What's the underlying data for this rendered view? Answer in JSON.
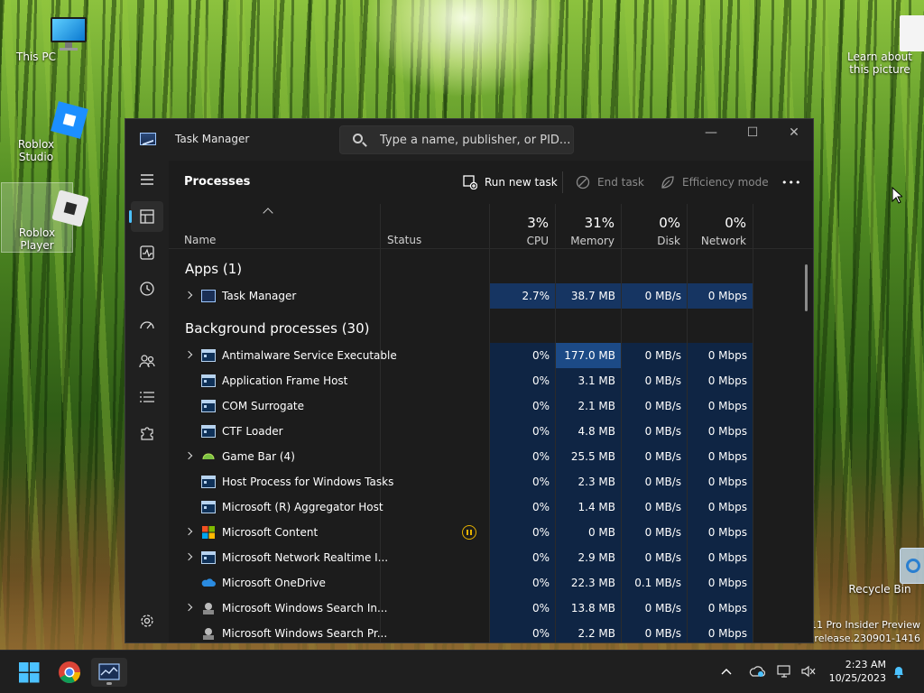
{
  "desktop": {
    "icons": {
      "this_pc": "This PC",
      "roblox_studio": "Roblox Studio",
      "roblox_player": "Roblox Player",
      "learn_about": "Learn about this picture",
      "recycle_bin": "Recycle Bin"
    },
    "watermark_line1": "11 Pro Insider Preview",
    "watermark_line2": "prerelease.230901-1416"
  },
  "window": {
    "title": "Task Manager",
    "search_placeholder": "Type a name, publisher, or PID...",
    "min_label": "—",
    "max_label": "☐",
    "close_label": "✕"
  },
  "header": {
    "page_title": "Processes",
    "run_new_task": "Run new task",
    "end_task": "End task",
    "efficiency_mode": "Efficiency mode",
    "more": "•••"
  },
  "columns": {
    "name": "Name",
    "status": "Status",
    "cpu_pct": "3%",
    "cpu": "CPU",
    "memory_pct": "31%",
    "memory": "Memory",
    "disk_pct": "0%",
    "disk": "Disk",
    "network_pct": "0%",
    "network": "Network"
  },
  "groups": {
    "apps": "Apps (1)",
    "background": "Background processes (30)"
  },
  "apps": [
    {
      "name": "Task Manager",
      "cpu": "2.7%",
      "memory": "38.7 MB",
      "disk": "0 MB/s",
      "network": "0 Mbps"
    }
  ],
  "background": [
    {
      "name": "Antimalware Service Executable",
      "cpu": "0%",
      "memory": "177.0 MB",
      "disk": "0 MB/s",
      "network": "0 Mbps"
    },
    {
      "name": "Application Frame Host",
      "cpu": "0%",
      "memory": "3.1 MB",
      "disk": "0 MB/s",
      "network": "0 Mbps"
    },
    {
      "name": "COM Surrogate",
      "cpu": "0%",
      "memory": "2.1 MB",
      "disk": "0 MB/s",
      "network": "0 Mbps"
    },
    {
      "name": "CTF Loader",
      "cpu": "0%",
      "memory": "4.8 MB",
      "disk": "0 MB/s",
      "network": "0 Mbps"
    },
    {
      "name": "Game Bar (4)",
      "cpu": "0%",
      "memory": "25.5 MB",
      "disk": "0 MB/s",
      "network": "0 Mbps"
    },
    {
      "name": "Host Process for Windows Tasks",
      "cpu": "0%",
      "memory": "2.3 MB",
      "disk": "0 MB/s",
      "network": "0 Mbps"
    },
    {
      "name": "Microsoft (R) Aggregator Host",
      "cpu": "0%",
      "memory": "1.4 MB",
      "disk": "0 MB/s",
      "network": "0 Mbps"
    },
    {
      "name": "Microsoft Content",
      "cpu": "0%",
      "memory": "0 MB",
      "disk": "0 MB/s",
      "network": "0 Mbps"
    },
    {
      "name": "Microsoft Network Realtime I...",
      "cpu": "0%",
      "memory": "2.9 MB",
      "disk": "0 MB/s",
      "network": "0 Mbps"
    },
    {
      "name": "Microsoft OneDrive",
      "cpu": "0%",
      "memory": "22.3 MB",
      "disk": "0.1 MB/s",
      "network": "0 Mbps"
    },
    {
      "name": "Microsoft Windows Search In...",
      "cpu": "0%",
      "memory": "13.8 MB",
      "disk": "0 MB/s",
      "network": "0 Mbps"
    },
    {
      "name": "Microsoft Windows Search Pr...",
      "cpu": "0%",
      "memory": "2.2 MB",
      "disk": "0 MB/s",
      "network": "0 Mbps"
    }
  ],
  "taskbar": {
    "time": "2:23 AM",
    "date": "10/25/2023"
  },
  "colors": {
    "accent": "#4cc2ff",
    "highlight": "#1c4a86",
    "status_suspended": "#e5b100"
  }
}
